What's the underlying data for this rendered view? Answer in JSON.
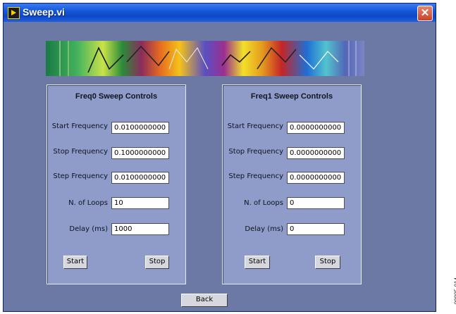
{
  "window": {
    "title": "Sweep.vi",
    "close_glyph": "✕",
    "background": "#6d79a5",
    "titlebar_color": "#1457d9"
  },
  "panels": [
    {
      "title": "Freq0 Sweep Controls",
      "fields": [
        {
          "label": "Start Frequency",
          "value": "0.0100000000"
        },
        {
          "label": "Stop Frequency",
          "value": "0.1000000000"
        },
        {
          "label": "Step Frequency",
          "value": "0.0100000000"
        },
        {
          "label": "N. of Loops",
          "value": "10"
        },
        {
          "label": "Delay (ms)",
          "value": "1000"
        }
      ],
      "start_label": "Start",
      "stop_label": "Stop"
    },
    {
      "title": "Freq1 Sweep Controls",
      "fields": [
        {
          "label": "Start Frequency",
          "value": "0.0000000000"
        },
        {
          "label": "Stop Frequency",
          "value": "0.0000000000"
        },
        {
          "label": "Step Frequency",
          "value": "0.0000000000"
        },
        {
          "label": "N. of Loops",
          "value": "0"
        },
        {
          "label": "Delay (ms)",
          "value": "0"
        }
      ],
      "start_label": "Start",
      "stop_label": "Stop"
    }
  ],
  "back_label": "Back",
  "figure_tag": "09805-014"
}
